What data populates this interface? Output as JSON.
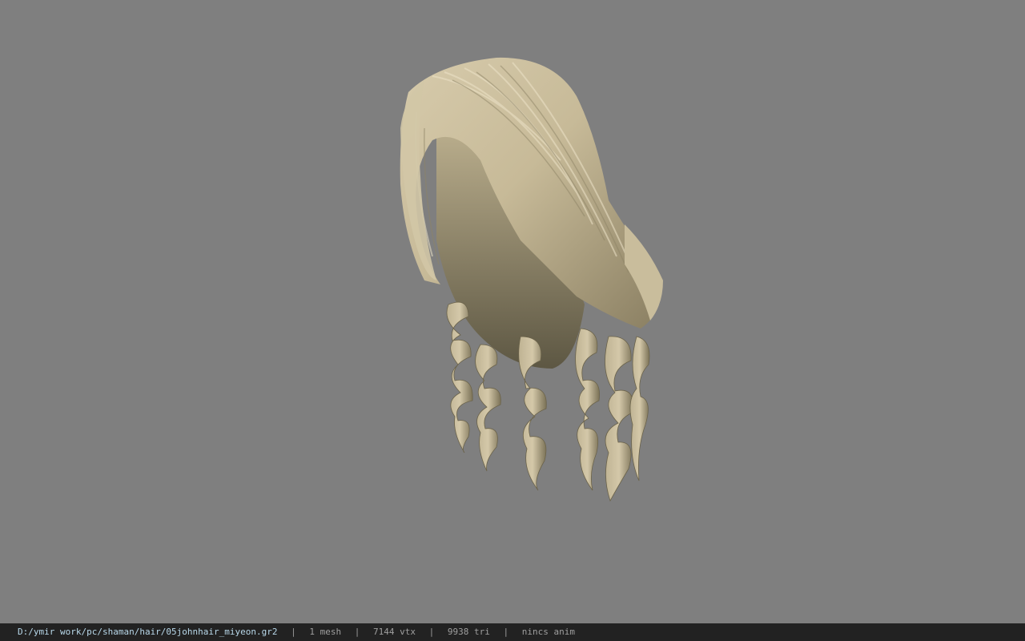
{
  "viewer": {
    "background_color": "#7f7f7f",
    "model_name": "hair-model",
    "hair_color": "#cbbf9f",
    "hair_shadow_color": "#6e664f"
  },
  "status": {
    "file_path": "D:/ymir work/pc/shaman/hair/05johnhair_miyeon.gr2",
    "separator": "|",
    "mesh_count": "1 mesh",
    "vertex_count": "7144 vtx",
    "triangle_count": "9938 tri",
    "animation": "nincs anim"
  }
}
